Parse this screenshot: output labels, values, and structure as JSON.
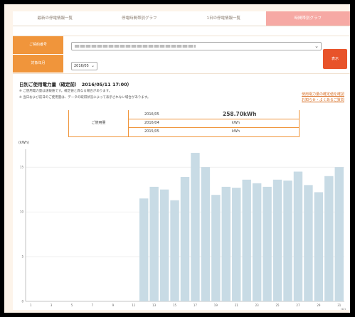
{
  "tabs": [
    {
      "label": "最新の停電情報一覧"
    },
    {
      "label": "停電時間帯別グラフ"
    },
    {
      "label": "1日の停電情報一覧"
    },
    {
      "label": "時間帯別グラフ"
    }
  ],
  "form": {
    "field1_label": "ご契約番号",
    "field2_label": "対象年月",
    "month_value": "2016/05",
    "submit_label": "表示"
  },
  "section": {
    "title": "日別ご使用電力量（確定前）　2016/05/11 17:00）",
    "note1": "※ ご使用電力量は速報値です。確定値と異なる場合があります。",
    "note2": "※ 当日および前日のご使用量は、データの取得状況によって表示されない場合があります。",
    "link1": "使用電力量の確定値を確認",
    "link2": "お知らせ・よくあるご質問"
  },
  "summary": {
    "header": "ご使用量",
    "rows": [
      {
        "period": "2016/05",
        "value": "258.70kWh"
      },
      {
        "period": "2016/04",
        "value": "kWh"
      },
      {
        "period": "2015/05",
        "value": "kWh"
      }
    ]
  },
  "chart_data": {
    "type": "bar",
    "ylabel": "(kWh)",
    "xunit": "(日)",
    "ylim": [
      0,
      17
    ],
    "yticks": [
      0,
      5,
      10,
      15
    ],
    "categories": [
      "1",
      "2",
      "3",
      "4",
      "5",
      "6",
      "7",
      "8",
      "9",
      "10",
      "11",
      "12",
      "13",
      "14",
      "15",
      "16",
      "17",
      "18",
      "19",
      "20",
      "21",
      "22",
      "23",
      "24",
      "25",
      "26",
      "27",
      "28",
      "29",
      "30",
      "31"
    ],
    "xtick_labels": [
      "1",
      "",
      "3",
      "",
      "5",
      "",
      "7",
      "",
      "9",
      "",
      "11",
      "",
      "13",
      "",
      "15",
      "",
      "17",
      "",
      "19",
      "",
      "21",
      "",
      "23",
      "",
      "25",
      "",
      "27",
      "",
      "29",
      "",
      "31"
    ],
    "values": [
      0,
      0,
      0,
      0,
      0,
      0,
      0,
      0,
      0,
      0,
      0,
      11.5,
      12.8,
      12.5,
      11.3,
      13.9,
      16.6,
      15.0,
      11.9,
      12.8,
      12.7,
      13.6,
      13.2,
      12.8,
      13.6,
      13.5,
      14.5,
      13.0,
      12.2,
      14.0,
      15.0
    ],
    "colors": {
      "bar": "#c8dbe5",
      "grid": "#e5e5e5"
    }
  }
}
